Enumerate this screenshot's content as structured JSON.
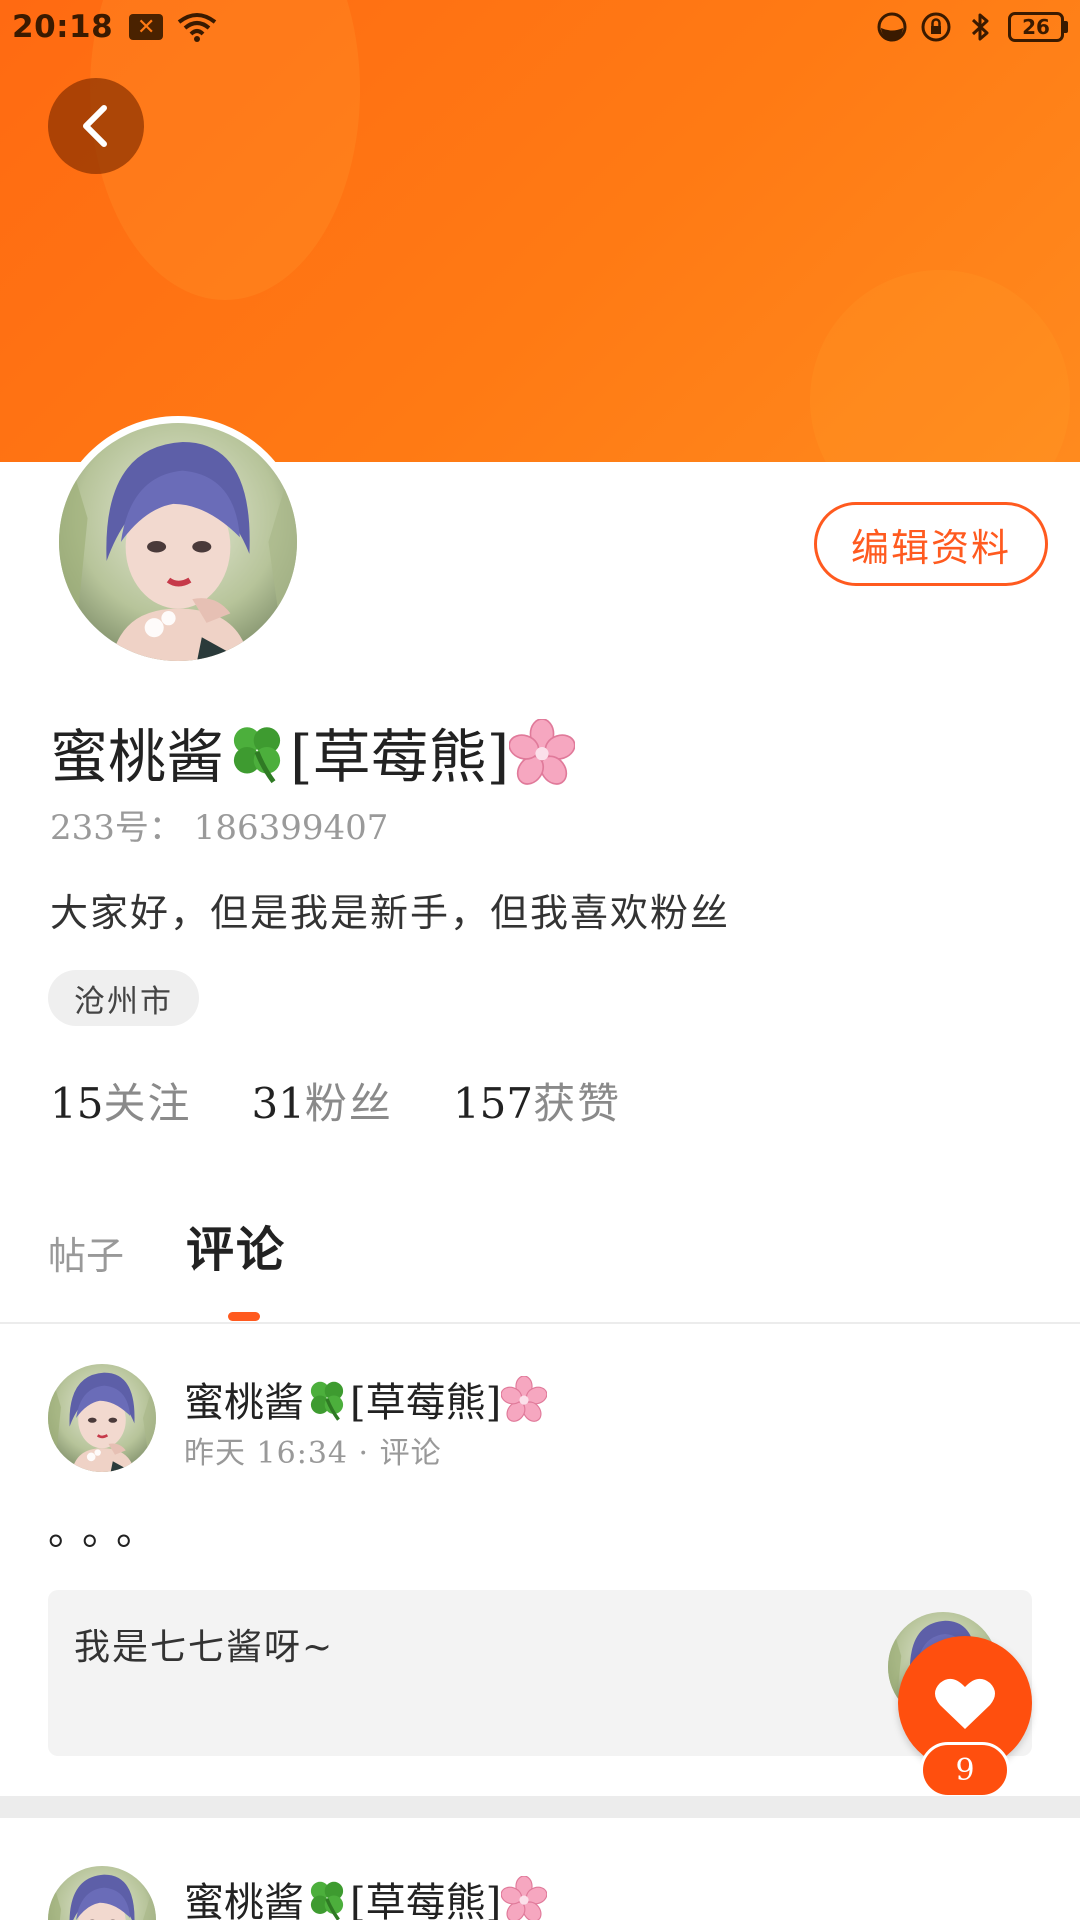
{
  "status_bar": {
    "time": "20:18",
    "notification_icon": "x-notification-icon",
    "battery": "26"
  },
  "header": {
    "back_icon": "chevron-left-icon",
    "edit_profile_label": "编辑资料"
  },
  "profile": {
    "name": "蜜桃酱",
    "name_suffix": "[草莓熊]",
    "uid": "233号：  186399407",
    "bio": "大家好，但是我是新手，但我喜欢粉丝",
    "location": "沧州市",
    "stats": [
      {
        "num": "15",
        "label": "关注"
      },
      {
        "num": "31",
        "label": "粉丝"
      },
      {
        "num": "157",
        "label": "获赞"
      }
    ]
  },
  "tabs": {
    "posts": "帖子",
    "comments": "评论",
    "active": "comments"
  },
  "feed": [
    {
      "author": "蜜桃酱",
      "author_suffix": "[草莓熊]",
      "meta": "昨天 16:34 · 评论",
      "content": "。。。",
      "quote": "我是七七酱呀~"
    },
    {
      "author": "蜜桃酱",
      "author_suffix": "[草莓熊]"
    }
  ],
  "like": {
    "count": "9"
  },
  "colors": {
    "accent": "#ff5a1f",
    "banner": "#ff7a14",
    "muted": "#999999"
  }
}
